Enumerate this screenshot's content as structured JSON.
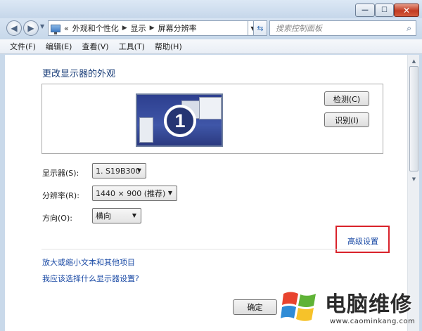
{
  "window": {
    "minimize_glyph": "—",
    "maximize_glyph": "☐",
    "close_glyph": "✕"
  },
  "address": {
    "overflow": "«",
    "breadcrumbs": [
      "外观和个性化",
      "显示",
      "屏幕分辨率"
    ],
    "search_placeholder": "搜索控制面板"
  },
  "menu": [
    "文件(F)",
    "编辑(E)",
    "查看(V)",
    "工具(T)",
    "帮助(H)"
  ],
  "main": {
    "title": "更改显示器的外观",
    "monitor_number": "1",
    "detect_button": "检测(C)",
    "identify_button": "识别(I)",
    "display_label": "显示器(S):",
    "display_value": "1. S19B300",
    "resolution_label": "分辨率(R):",
    "resolution_value": "1440 × 900 (推荐)",
    "orientation_label": "方向(O):",
    "orientation_value": "横向",
    "advanced_link": "高级设置",
    "link_text_size": "放大或缩小文本和其他项目",
    "link_which_settings": "我应该选择什么显示器设置?",
    "ok_button": "确定"
  },
  "watermark": {
    "text": "电脑维修",
    "url": "www.caominkang.com"
  },
  "colors": {
    "highlight_border": "#d9232b",
    "link": "#1a4aa5",
    "title": "#1b3f7a"
  },
  "icons": [
    "back-arrow-icon",
    "forward-arrow-icon",
    "monitor-icon",
    "refresh-icon",
    "search-icon",
    "windows-logo-icon"
  ]
}
